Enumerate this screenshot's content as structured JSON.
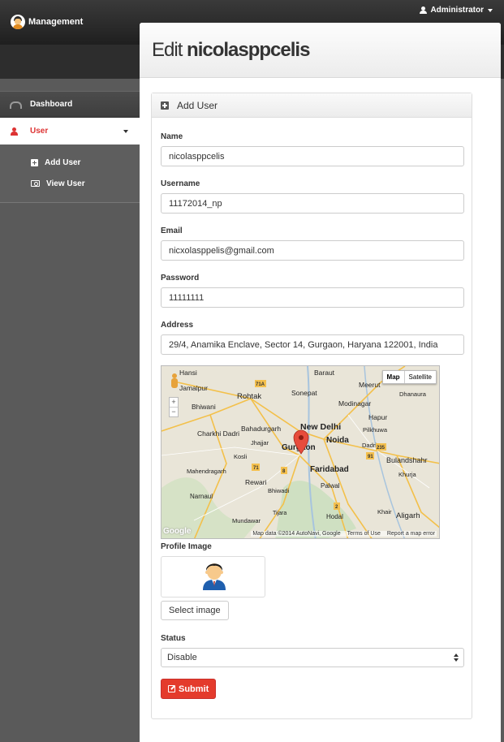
{
  "header": {
    "brand": "Management",
    "user": "Administrator"
  },
  "sidebar": {
    "items": [
      {
        "label": "Dashboard",
        "icon": "dashboard-icon"
      },
      {
        "label": "User",
        "icon": "user-icon",
        "active": true,
        "accent": "#dd3333"
      }
    ],
    "submenu": [
      {
        "label": "Add User",
        "icon": "plus-square-icon"
      },
      {
        "label": "View User",
        "icon": "view-icon"
      }
    ]
  },
  "page": {
    "title_prefix": "Edit",
    "title_name": "nicolasppcelis"
  },
  "form": {
    "card_title": "Add User",
    "name_label": "Name",
    "name_value": "nicolasppcelis",
    "username_label": "Username",
    "username_value": "11172014_np",
    "email_label": "Email",
    "email_value": "nicxolasppelis@gmail.com",
    "password_label": "Password",
    "password_value": "11111111",
    "address_label": "Address",
    "address_value": "29/4, Anamika Enclave, Sector 14, Gurgaon, Haryana 122001, India",
    "profile_image_label": "Profile Image",
    "select_image_label": "Select image",
    "status_label": "Status",
    "status_value": "Disable",
    "submit_label": "Submit",
    "submit_color": "#e43b2c"
  },
  "map": {
    "type_map": "Map",
    "type_satellite": "Satellite",
    "zoom_in": "+",
    "zoom_out": "−",
    "logo": "Google",
    "data_credit": "Map data ©2014 AutoNavi, Google",
    "terms": "Terms of Use",
    "report": "Report a map error",
    "places": {
      "hansi": "Hansi",
      "jamalpur": "Jamalpur",
      "bhiwani": "Bhiwani",
      "rohtak": "Rohtak",
      "sonepat": "Sonepat",
      "baraut": "Baraut",
      "meerut": "Meerut",
      "dhanaura": "Dhanaura",
      "modinagar": "Modinagar",
      "hapur": "Hapur",
      "bahadurgarh": "Bahadurgarh",
      "new_delhi": "New Delhi",
      "charkhi_dadri": "Charkhi Dadri",
      "jhajjar": "Jhajjar",
      "gurgaon": "Gurgaon",
      "noida": "Noida",
      "dadri": "Dadri",
      "pilkhuwa": "Pilkhuwa",
      "kosli": "Kosli",
      "faridabad": "Faridabad",
      "bulandshahr": "Bulandshahr",
      "mahendragarh": "Mahendragarh",
      "rewari": "Rewari",
      "bhiwadi": "Bhiwadi",
      "khurja": "Khurja",
      "narnaul": "Narnaul",
      "palwal": "Palwal",
      "tijara": "Tijara",
      "khair": "Khair",
      "aligarh": "Aligarh",
      "mundawar": "Mundawar",
      "hodal": "Hodal",
      "r71a": "71A",
      "r71": "71",
      "r8": "8",
      "r91": "91",
      "r235": "235",
      "r2": "2"
    }
  }
}
